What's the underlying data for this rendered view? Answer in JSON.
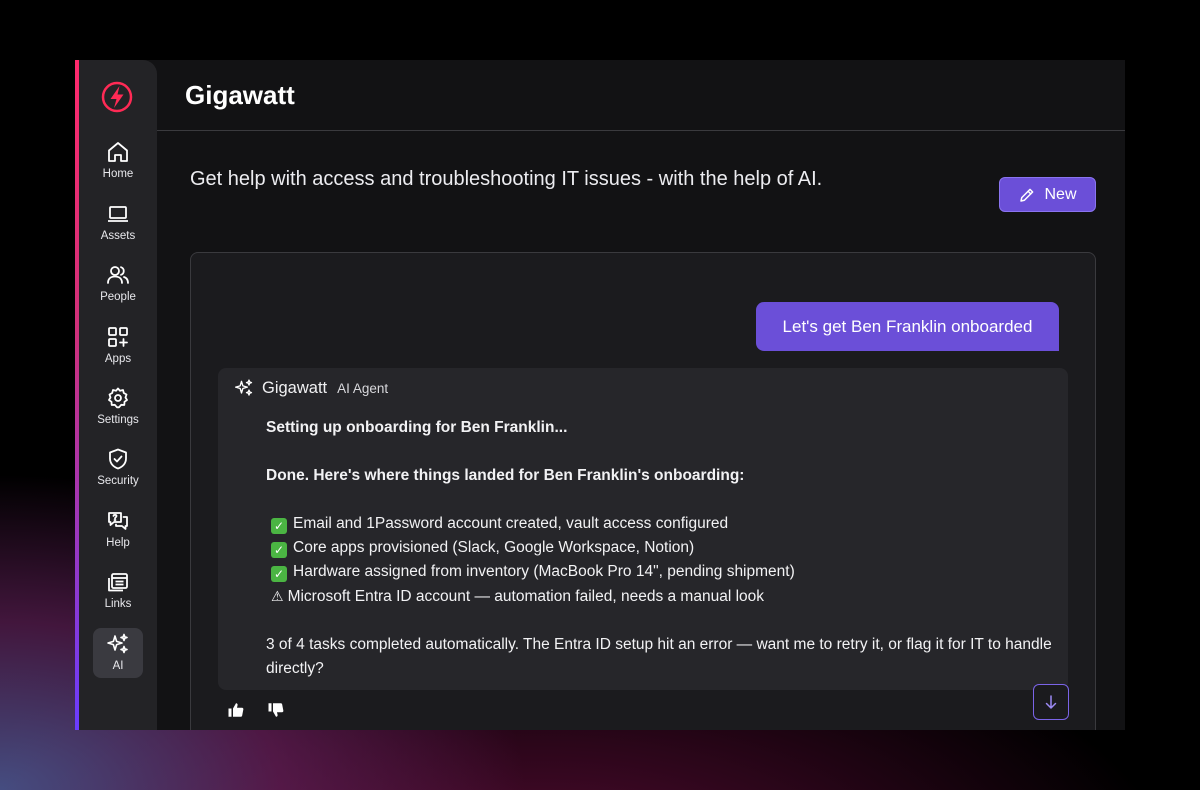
{
  "app": {
    "title": "Gigawatt"
  },
  "sidebar": {
    "items": [
      {
        "label": "Home",
        "icon": "home-icon"
      },
      {
        "label": "Assets",
        "icon": "laptop-icon"
      },
      {
        "label": "People",
        "icon": "people-icon"
      },
      {
        "label": "Apps",
        "icon": "apps-grid-icon"
      },
      {
        "label": "Settings",
        "icon": "gear-icon"
      },
      {
        "label": "Security",
        "icon": "shield-check-icon"
      },
      {
        "label": "Help",
        "icon": "help-chat-icon"
      },
      {
        "label": "Links",
        "icon": "links-icon"
      },
      {
        "label": "AI",
        "icon": "sparkles-icon",
        "active": true
      }
    ]
  },
  "main": {
    "tagline": "Get help with access and troubleshooting IT issues - with the help of AI.",
    "new_button": "New"
  },
  "chat": {
    "user_message": "Let's get Ben Franklin onboarded",
    "agent": {
      "name": "Gigawatt",
      "tag": "AI Agent",
      "status_line": "Setting up onboarding for Ben Franklin...",
      "done_line": "Done. Here's where things landed for Ben Franklin's onboarding:",
      "results": [
        {
          "status": "success",
          "text": "Email and 1Password account created, vault access configured"
        },
        {
          "status": "success",
          "text": "Core apps provisioned (Slack, Google Workspace, Notion)"
        },
        {
          "status": "success",
          "text": "Hardware assigned from inventory (MacBook Pro 14\", pending shipment)"
        },
        {
          "status": "warning",
          "text": "Microsoft Entra ID account — automation failed, needs a manual look"
        }
      ],
      "summary": "3 of 4 tasks completed automatically. The Entra ID setup hit an error — want me to retry it, or flag it for IT to handle directly?"
    }
  },
  "colors": {
    "accent": "#6b4fd8",
    "brand_red": "#ff2a55",
    "success": "#4bb543"
  }
}
